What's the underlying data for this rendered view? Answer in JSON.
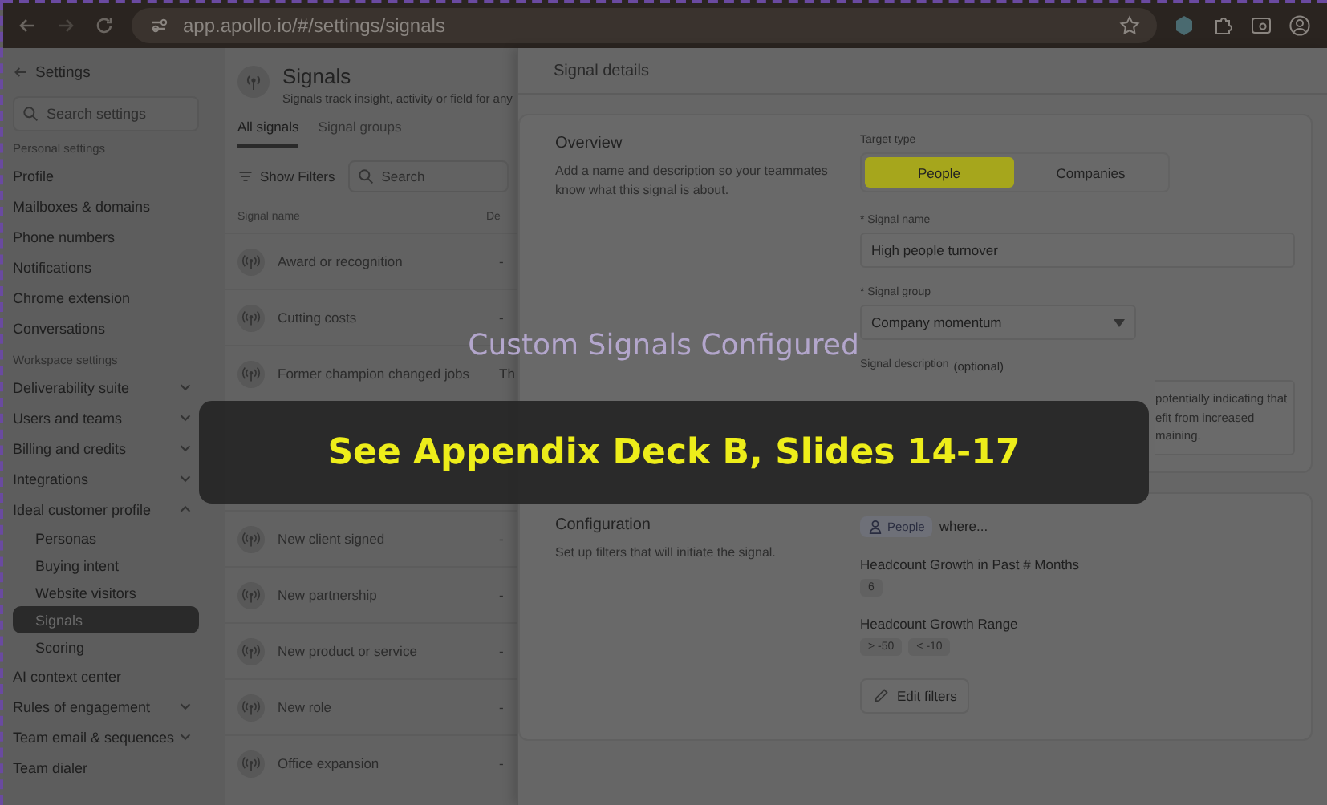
{
  "browser": {
    "url": "app.apollo.io/#/settings/signals"
  },
  "sidebar": {
    "back_label": "Settings",
    "search": {
      "placeholder": "Search settings"
    },
    "sections": [
      {
        "title": "Personal settings",
        "items": [
          {
            "label": "Profile",
            "selected": false
          },
          {
            "label": "Mailboxes & domains",
            "selected": false
          },
          {
            "label": "Phone numbers",
            "selected": false
          },
          {
            "label": "Notifications",
            "selected": false
          },
          {
            "label": "Chrome extension",
            "selected": false
          },
          {
            "label": "Conversations",
            "selected": false
          }
        ]
      },
      {
        "title": "Workspace settings",
        "items": [
          {
            "label": "Deliverability suite",
            "selected": false,
            "expanded": false
          },
          {
            "label": "Users and teams",
            "selected": false,
            "expanded": false
          },
          {
            "label": "Billing and credits",
            "selected": false,
            "expanded": false
          },
          {
            "label": "Integrations",
            "selected": false,
            "expanded": false
          },
          {
            "label": "Ideal customer profile",
            "selected": false,
            "expanded": true,
            "children": [
              {
                "label": "Personas",
                "selected": false
              },
              {
                "label": "Buying intent",
                "selected": false
              },
              {
                "label": "Website visitors",
                "selected": false
              },
              {
                "label": "Signals",
                "selected": true
              },
              {
                "label": "Scoring",
                "selected": false
              }
            ]
          },
          {
            "label": "AI context center",
            "selected": false
          },
          {
            "label": "Rules of engagement",
            "selected": false,
            "expanded": false
          },
          {
            "label": "Team email & sequences",
            "selected": false,
            "expanded": false
          },
          {
            "label": "Team dialer",
            "selected": false
          }
        ]
      }
    ]
  },
  "signals_panel": {
    "title": "Signals",
    "subtitle": "Signals track insight, activity or field for any",
    "tabs": [
      {
        "label": "All signals",
        "selected": true
      },
      {
        "label": "Signal groups",
        "selected": false
      }
    ],
    "filter_button": "Show Filters",
    "search": {
      "placeholder": "Search"
    },
    "table": {
      "columns": [
        "Signal name",
        "De"
      ],
      "rows": [
        [
          "Award or recognition",
          "-"
        ],
        [
          "Cutting costs",
          "-"
        ],
        [
          "Former champion changed jobs",
          "Th"
        ],
        [
          "New client signed",
          "-"
        ],
        [
          "New partnership",
          "-"
        ],
        [
          "New product or service",
          "-"
        ],
        [
          "New role",
          "-"
        ],
        [
          "Office expansion",
          "-"
        ]
      ]
    }
  },
  "details": {
    "title": "Signal details",
    "overview": {
      "title": "Overview",
      "description": "Add a name and description so your teammates know what this signal is about.",
      "target_type": {
        "label": "Target type",
        "options": [
          {
            "label": "People",
            "selected": true
          },
          {
            "label": "Companies",
            "selected": false
          }
        ]
      },
      "signal_name": {
        "label": "* Signal name",
        "value": "High people turnover"
      },
      "signal_group": {
        "label": "* Signal group",
        "value": "Company momentum"
      },
      "signal_description": {
        "label": "Signal description",
        "hint": "(optional)",
        "visible_lines": [
          "potentially indicating that",
          "efit from increased",
          "maining."
        ]
      }
    },
    "configuration": {
      "title": "Configuration",
      "description": "Set up filters that will initiate the signal.",
      "entity_chip": "People",
      "where": "where...",
      "filters": [
        {
          "label": "Headcount Growth in Past # Months",
          "values": [
            "6"
          ]
        },
        {
          "label": "Headcount Growth Range",
          "values": [
            "> -50",
            "< -10"
          ]
        }
      ],
      "edit_button": "Edit filters"
    }
  },
  "overlay": {
    "caption": "Custom Signals Configured",
    "banner": "See Appendix Deck B, Slides 14-17"
  }
}
